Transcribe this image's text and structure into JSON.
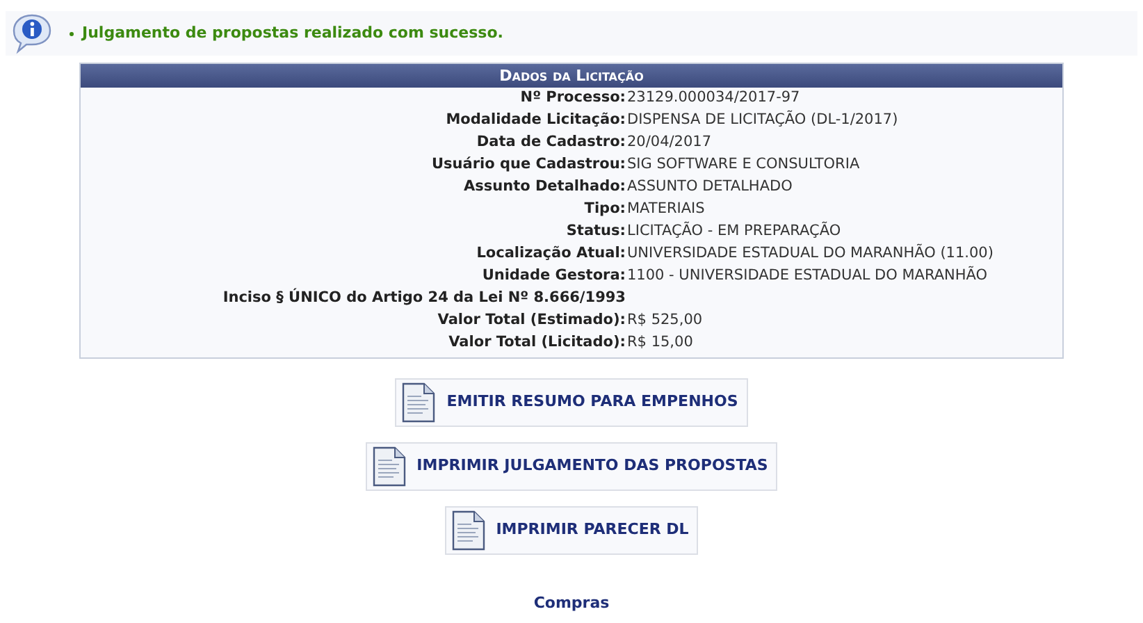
{
  "message": {
    "text": "Julgamento de propostas realizado com sucesso."
  },
  "details": {
    "title": "Dados da Licitação",
    "rows": [
      {
        "kind": "field",
        "label": "Nº Processo:",
        "value": "23129.000034/2017-97"
      },
      {
        "kind": "field",
        "label": "Modalidade Licitação:",
        "value": "DISPENSA DE LICITAÇÃO (DL-1/2017)"
      },
      {
        "kind": "field",
        "label": "Data de Cadastro:",
        "value": "20/04/2017"
      },
      {
        "kind": "field",
        "label": "Usuário que Cadastrou:",
        "value": "SIG SOFTWARE E CONSULTORIA"
      },
      {
        "kind": "field",
        "label": "Assunto Detalhado:",
        "value": "ASSUNTO DETALHADO"
      },
      {
        "kind": "field",
        "label": "Tipo:",
        "value": "MATERIAIS"
      },
      {
        "kind": "field",
        "label": "Status:",
        "value": "LICITAÇÃO - EM PREPARAÇÃO"
      },
      {
        "kind": "field",
        "label": "Localização Atual:",
        "value": "UNIVERSIDADE ESTADUAL DO MARANHÃO (11.00)"
      },
      {
        "kind": "field",
        "label": "Unidade Gestora:",
        "value": "1100 - UNIVERSIDADE ESTADUAL DO MARANHÃO"
      },
      {
        "kind": "note",
        "label": "Inciso § ÚNICO do Artigo 24 da Lei Nº 8.666/1993"
      },
      {
        "kind": "field",
        "label": "Valor Total (Estimado):",
        "value": "R$ 525,00"
      },
      {
        "kind": "field",
        "label": "Valor Total (Licitado):",
        "value": "R$ 15,00"
      }
    ]
  },
  "actions": [
    "EMITIR RESUMO PARA EMPENHOS",
    "IMPRIMIR JULGAMENTO DAS PROPOSTAS",
    "IMPRIMIR PARECER DL"
  ],
  "footer_link": "Compras"
}
